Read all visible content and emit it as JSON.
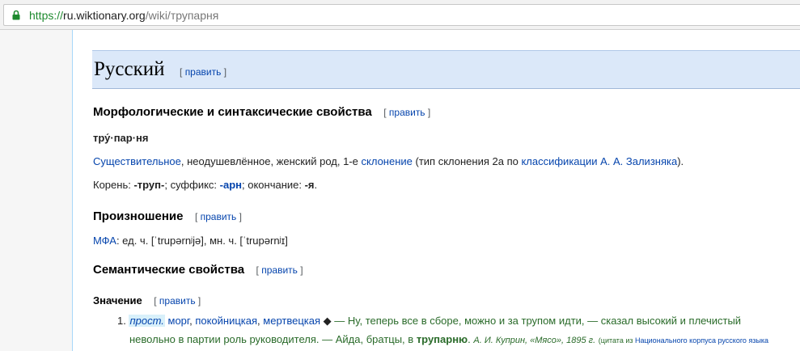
{
  "browser": {
    "url_scheme": "https://",
    "url_host": "ru.wiktionary.org",
    "url_path": "/wiki/трупарня"
  },
  "page": {
    "language_heading": "Русский",
    "edit_label": "править",
    "bracket_open": "[",
    "bracket_close": "]",
    "morph_heading": "Морфологические и синтаксические свойства",
    "syllables": "тру́·пар·ня",
    "pos_line": {
      "noun_link": "Существительное",
      "props": ", неодушевлённое, женский род, 1-е ",
      "decl_link": "склонение",
      "type_text": " (тип склонения 2a по ",
      "zaliz_link": "классификации А. А. Зализняка",
      "end": ")."
    },
    "morphemes": {
      "root_label": "Корень: ",
      "root": "-труп-",
      "suffix_label": "; суффикс: ",
      "suffix": "-арн",
      "ending_label": "; окончание: ",
      "ending": "-я",
      "end": "."
    },
    "pron_heading": "Произношение",
    "ipa_line": {
      "ipa_link": "МФА",
      "text": ": ед. ч. [ˈtrupərnʲjə], мн. ч. [ˈtrupərnʲɪ]"
    },
    "sem_heading": "Семантические свойства",
    "meaning_heading": "Значение",
    "definition": {
      "number": "1.",
      "label": "прост.",
      "link1": "морг",
      "sep1": ", ",
      "link2": "покойницкая",
      "sep2": ", ",
      "link3": "мертвецкая",
      "diamond": " ◆ ",
      "quote_part1": "— Ну, теперь все в сборе, можно и за трупом идти, — сказал высокий и плечистый ",
      "quote_part2": "невольно в партии роль руководителя. — Айда, братцы, в ",
      "bold_word": "трупарню",
      "after_bold": ".",
      "source": "А. И. Куприн, «Мясо», 1895 г.",
      "cite_open": "(цитата из ",
      "cite_link": "Национального корпуса русского языка"
    }
  }
}
